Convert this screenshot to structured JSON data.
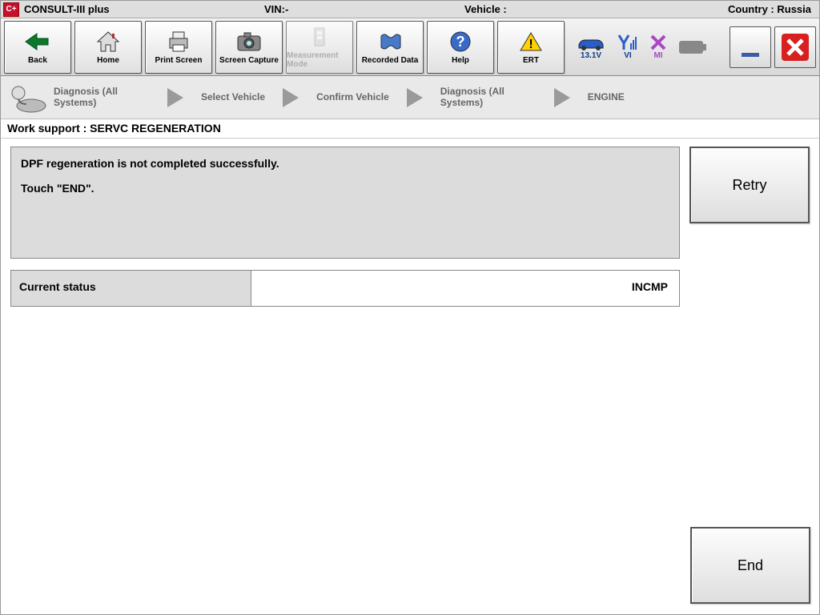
{
  "topbar": {
    "logo_text": "C+",
    "app_name": "CONSULT-III plus",
    "vin_label": "VIN:-",
    "vehicle_label": "Vehicle :",
    "country_label": "Country : Russia"
  },
  "toolbar": {
    "back": "Back",
    "home": "Home",
    "print": "Print Screen",
    "capture": "Screen Capture",
    "measurement": "Measurement Mode",
    "recorded": "Recorded Data",
    "help": "Help",
    "ert": "ERT"
  },
  "status": {
    "voltage": "13.1V",
    "vi": "VI",
    "mi": "MI"
  },
  "breadcrumbs": {
    "step1": "Diagnosis (All Systems)",
    "step2": "Select Vehicle",
    "step3": "Confirm Vehicle",
    "step4": "Diagnosis (All Systems)",
    "step5": "ENGINE"
  },
  "subheader": "Work support : SERVC REGENERATION",
  "message": {
    "line1": "DPF regeneration is not completed successfully.",
    "line2": "Touch \"END\"."
  },
  "status_row": {
    "label": "Current status",
    "value": "INCMP"
  },
  "buttons": {
    "retry": "Retry",
    "end": "End"
  }
}
